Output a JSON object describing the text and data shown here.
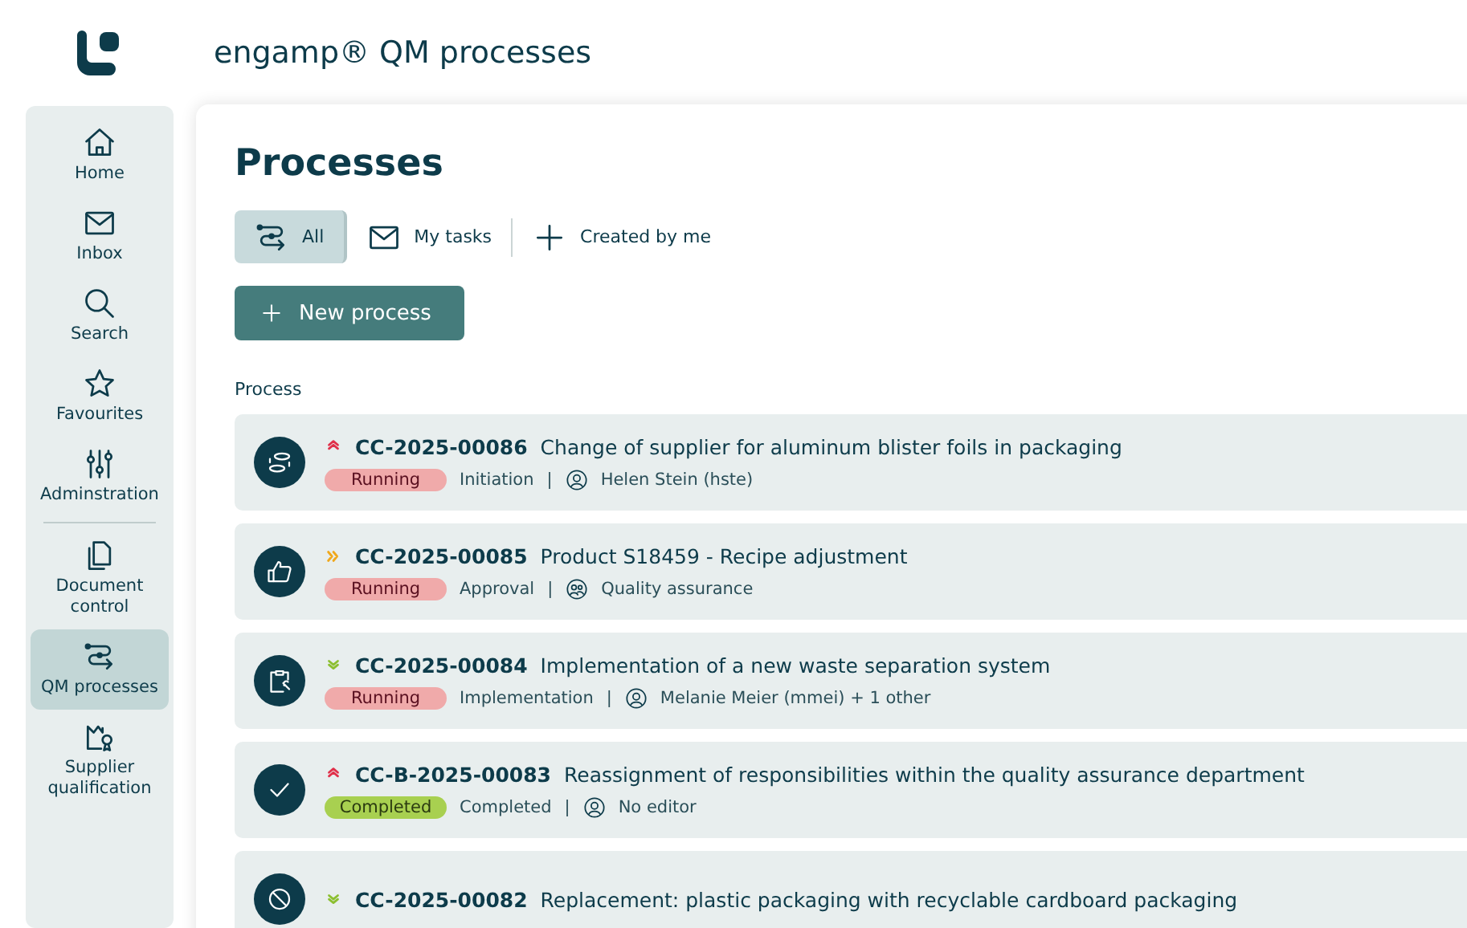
{
  "app": {
    "title": "engamp® QM processes"
  },
  "sidebar": {
    "items": [
      {
        "label": "Home",
        "selected": false,
        "divider_after": false
      },
      {
        "label": "Inbox",
        "selected": false,
        "divider_after": false
      },
      {
        "label": "Search",
        "selected": false,
        "divider_after": false
      },
      {
        "label": "Favourites",
        "selected": false,
        "divider_after": false
      },
      {
        "label": "Adminstration",
        "selected": false,
        "divider_after": true
      },
      {
        "label": "Document control",
        "selected": false,
        "divider_after": false
      },
      {
        "label": "QM processes",
        "selected": true,
        "divider_after": false
      },
      {
        "label": "Supplier qualification",
        "selected": false,
        "divider_after": false
      }
    ]
  },
  "page": {
    "title": "Processes",
    "filters": [
      {
        "label": "All",
        "selected": true
      },
      {
        "label": "My tasks",
        "selected": false
      },
      {
        "label": "Created by me",
        "selected": false
      }
    ],
    "new_button": "New process",
    "column_header": "Process",
    "rows": [
      {
        "priority": {
          "kind": "high"
        },
        "id": "CC-2025-00086",
        "title": "Change of supplier for aluminum blister foils in packaging",
        "status": {
          "label": "Running",
          "kind": "running"
        },
        "phase": "Initiation",
        "separator": "|",
        "assignee": {
          "name": "Helen Stein (hste)",
          "kind": "person"
        }
      },
      {
        "priority": {
          "kind": "medium"
        },
        "id": "CC-2025-00085",
        "title": "Product S18459 - Recipe adjustment",
        "status": {
          "label": "Running",
          "kind": "running"
        },
        "phase": "Approval",
        "separator": "|",
        "assignee": {
          "name": "Quality assurance",
          "kind": "group"
        }
      },
      {
        "priority": {
          "kind": "low"
        },
        "id": "CC-2025-00084",
        "title": "Implementation of a new waste separation system",
        "status": {
          "label": "Running",
          "kind": "running"
        },
        "phase": "Implementation",
        "separator": "|",
        "assignee": {
          "name": "Melanie Meier (mmei) + 1 other",
          "kind": "person"
        }
      },
      {
        "priority": {
          "kind": "high"
        },
        "id": "CC-B-2025-00083",
        "title": "Reassignment of responsibilities within the quality assurance department",
        "status": {
          "label": "Completed",
          "kind": "completed"
        },
        "phase": "Completed",
        "separator": "|",
        "assignee": {
          "name": "No editor",
          "kind": "person"
        }
      },
      {
        "priority": {
          "kind": "low"
        },
        "id": "CC-2025-00082",
        "title": "Replacement: plastic packaging with recyclable cardboard packaging"
      }
    ]
  }
}
